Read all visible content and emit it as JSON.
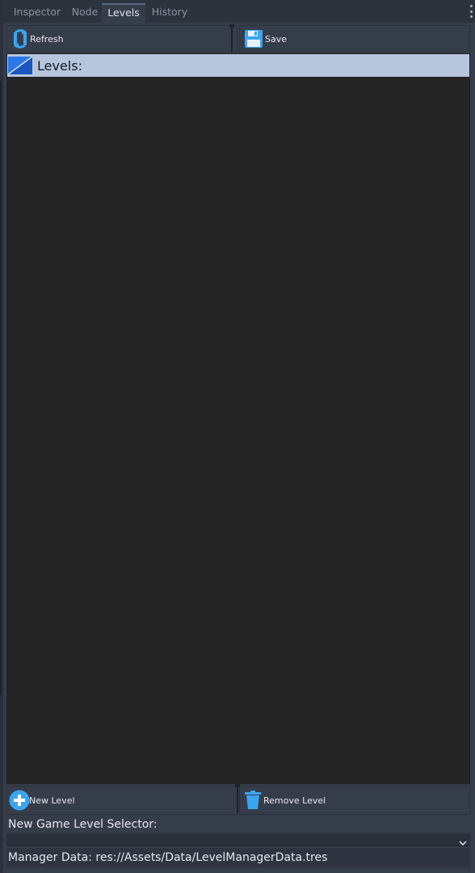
{
  "tabs": [
    {
      "label": "Inspector",
      "active": false
    },
    {
      "label": "Node",
      "active": false
    },
    {
      "label": "Levels",
      "active": true
    },
    {
      "label": "History",
      "active": false
    }
  ],
  "toolbar": {
    "refresh_label": "Refresh",
    "save_label": "Save"
  },
  "header": {
    "title": "Levels:"
  },
  "levels": [],
  "bottom": {
    "new_level_label": "New Level",
    "remove_level_label": "Remove Level"
  },
  "selector": {
    "label": "New Game Level Selector:",
    "value": ""
  },
  "manager": {
    "text": "Manager Data: res://Assets/Data/LevelManagerData.tres"
  },
  "colors": {
    "header_bg": "#b7c6dc",
    "list_bg": "#252525",
    "panel_bg": "#363d4a",
    "accent": "#3fa9f5"
  },
  "icons": {
    "refresh": "refresh-icon",
    "save": "floppy-disk-icon",
    "levels": "level-icon",
    "new_level": "plus-circle-icon",
    "remove_level": "trash-icon",
    "menu": "kebab-menu-icon",
    "dropdown": "chevron-down-icon"
  }
}
